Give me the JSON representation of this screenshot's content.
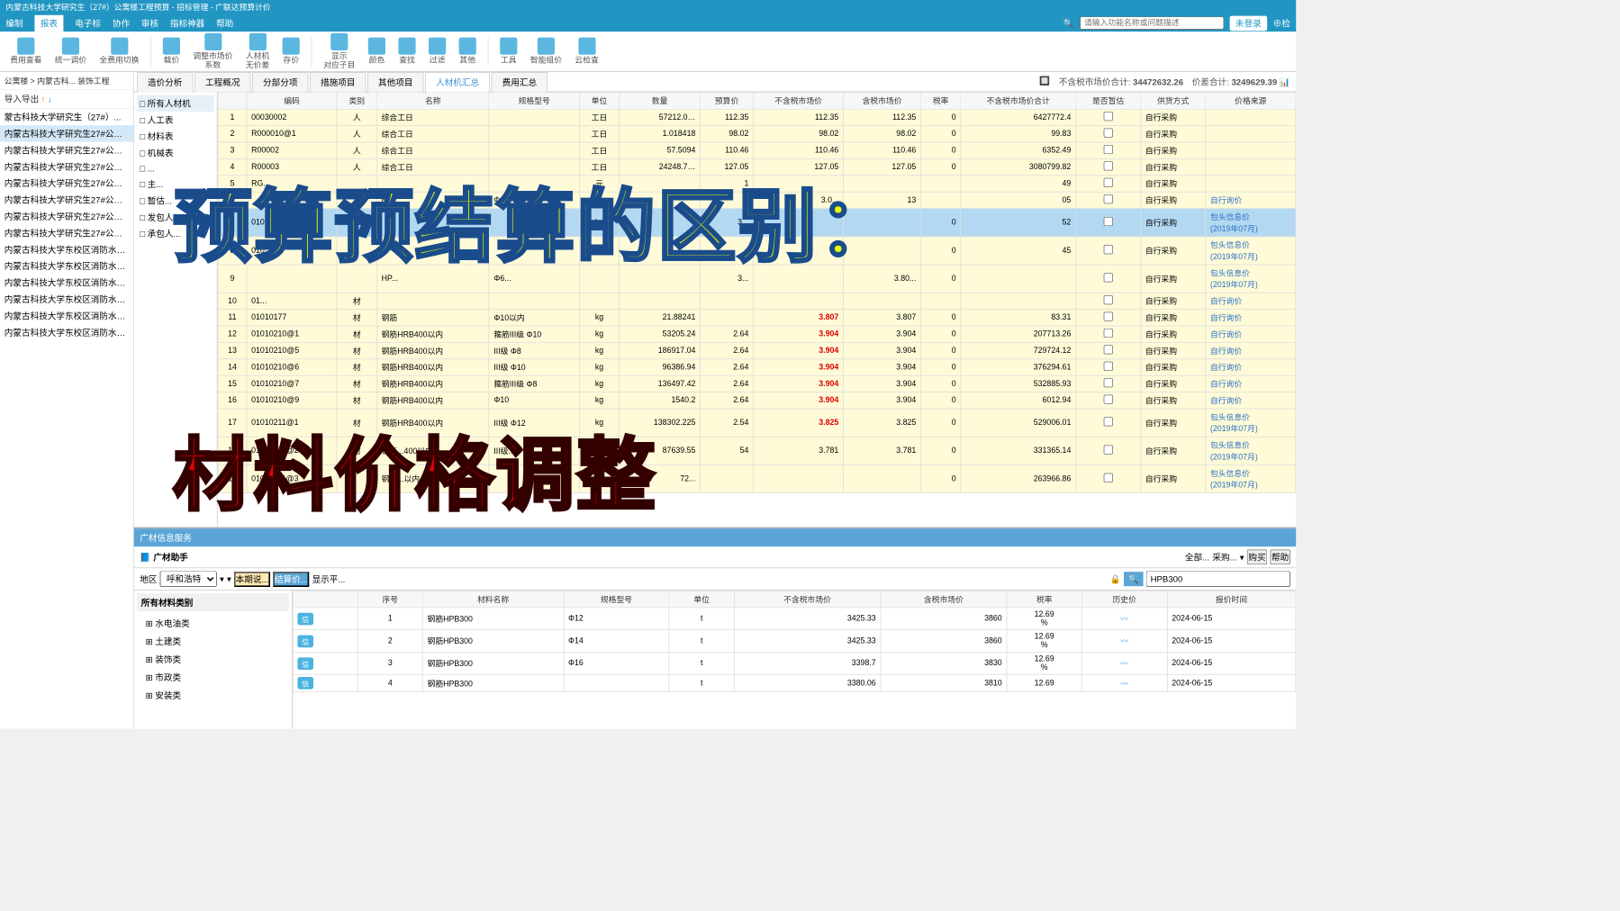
{
  "title_bar": "内蒙古科技大学研究生（27#）公寓楼工程预算 - 招标管理 - 广联达预算计价",
  "menu": [
    "编制",
    "报表",
    "电子标",
    "协作",
    "审核",
    "指标神器",
    "帮助"
  ],
  "search_placeholder": "请输入功能名称或问题描述",
  "login_btn": "未登录",
  "toolbar": [
    "费用查看",
    "统一调价",
    "全费用切换",
    "|",
    "载价",
    "调整市场价\n系数",
    "人材机\n无价差",
    "存价",
    "|",
    "显示\n对应子目",
    "颜色",
    "查找",
    "过滤",
    "其他",
    "|",
    "工具",
    "智能组价",
    "云检查"
  ],
  "breadcrumb": "公寓楼 > 内蒙古科... 装饰工程",
  "export_label": "导入导出",
  "projects": [
    "蒙古科技大学研究生（27#）...",
    "内蒙古科技大学研究生27#公寓...",
    "内蒙古科技大学研究生27#公寓...",
    "内蒙古科技大学研究生27#公寓...",
    "内蒙古科技大学研究生27#公寓...",
    "内蒙古科技大学研究生27#公寓...",
    "内蒙古科技大学研究生27#公寓...",
    "内蒙古科技大学研究生27#公寓...",
    "内蒙古科技大学东校区消防水池...",
    "内蒙古科技大学东校区消防水池...",
    "内蒙古科技大学东校区消防水池...",
    "内蒙古科技大学东校区消防水池...",
    "内蒙古科技大学东校区消防水池...",
    "内蒙古科技大学东校区消防水池..."
  ],
  "tabs": [
    "造价分析",
    "工程概况",
    "分部分项",
    "措施项目",
    "其他项目",
    "人材机汇总",
    "费用汇总"
  ],
  "summary": {
    "market_label": "不含税市场价合计:",
    "market_val": "34472632.26",
    "diff_label": "价差合计:",
    "diff_val": "3249629.39"
  },
  "tree": [
    "□ 所有人材机",
    "  □ 人工表",
    "  □ 材料表",
    "  □ 机械表",
    "  □ ...",
    "□ 主...",
    "□ 暂估...",
    "□ 发包人...",
    "□ 承包人..."
  ],
  "columns": [
    "编码",
    "类别",
    "名称",
    "规格型号",
    "单位",
    "数量",
    "预算价",
    "不含税市场价",
    "含税市场价",
    "税率",
    "不含税市场价合计",
    "是否暂估",
    "供货方式",
    "价格来源"
  ],
  "rows": [
    {
      "n": 1,
      "code": "00030002",
      "cat": "人",
      "name": "综合工日",
      "spec": "",
      "unit": "工日",
      "qty": "57212.0…",
      "budget": "112.35",
      "nt": "112.35",
      "t": "112.35",
      "rate": "0",
      "total": "6427772.4",
      "supply": "自行采购",
      "src": ""
    },
    {
      "n": 2,
      "code": "R000010@1",
      "cat": "人",
      "name": "综合工日",
      "spec": "",
      "unit": "工日",
      "qty": "1.018418",
      "budget": "98.02",
      "nt": "98.02",
      "t": "98.02",
      "rate": "0",
      "total": "99.83",
      "supply": "自行采购",
      "src": ""
    },
    {
      "n": 3,
      "code": "R00002",
      "cat": "人",
      "name": "综合工日",
      "spec": "",
      "unit": "工日",
      "qty": "57.5094",
      "budget": "110.46",
      "nt": "110.46",
      "t": "110.46",
      "rate": "0",
      "total": "6352.49",
      "supply": "自行采购",
      "src": ""
    },
    {
      "n": 4,
      "code": "R00003",
      "cat": "人",
      "name": "综合工日",
      "spec": "",
      "unit": "工日",
      "qty": "24248.7…",
      "budget": "127.05",
      "nt": "127.05",
      "t": "127.05",
      "rate": "0",
      "total": "3080799.82",
      "supply": "自行采购",
      "src": ""
    },
    {
      "n": 5,
      "code": "RG...",
      "cat": "",
      "name": "",
      "spec": "",
      "unit": "元",
      "qty": "",
      "budget": "1",
      "nt": "",
      "t": "",
      "rate": "",
      "total": "49",
      "supply": "自行采购",
      "src": ""
    },
    {
      "n": 6,
      "code": "",
      "cat": "",
      "name": "HP...",
      "spec": "Φ...",
      "unit": "",
      "qty": "",
      "budget": "",
      "nt": "3.0...",
      "t": "13",
      "rate": "",
      "total": "05",
      "supply": "自行采购",
      "src": "自行询价"
    },
    {
      "n": 7,
      "code": "010...",
      "cat": "",
      "name": "",
      "spec": "",
      "unit": "kg",
      "qty": "",
      "budget": "3...",
      "nt": "",
      "t": "",
      "rate": "0",
      "total": "52",
      "supply": "自行采购",
      "src": "包头信息价\n(2019年07月)",
      "sel": true
    },
    {
      "n": 8,
      "code": "010...",
      "cat": "",
      "name": "",
      "spec": "",
      "unit": "kg",
      "qty": "",
      "budget": "",
      "nt": "",
      "t": "",
      "rate": "0",
      "total": "45",
      "supply": "自行采购",
      "src": "包头信息价\n(2019年07月)"
    },
    {
      "n": 9,
      "code": "",
      "cat": "",
      "name": "HP...",
      "spec": "Φ6...",
      "unit": "",
      "qty": "",
      "budget": "3...",
      "nt": "",
      "t": "3.80...",
      "rate": "0",
      "total": "",
      "supply": "自行采购",
      "src": "包头信息价\n(2019年07月)"
    },
    {
      "n": 10,
      "code": "01...",
      "cat": "材",
      "name": "",
      "spec": "",
      "unit": "",
      "qty": "",
      "budget": "",
      "nt": "",
      "t": "",
      "rate": "",
      "total": "",
      "supply": "自行采购",
      "src": "自行询价"
    },
    {
      "n": 11,
      "code": "01010177",
      "cat": "材",
      "name": "钢筋",
      "spec": "Φ10以内",
      "unit": "kg",
      "qty": "21.88241",
      "budget": "",
      "nt": "3.807",
      "t": "3.807",
      "rate": "0",
      "total": "83.31",
      "supply": "自行采购",
      "src": "自行询价",
      "hi": true
    },
    {
      "n": 12,
      "code": "01010210@1",
      "cat": "材",
      "name": "钢筋HRB400以内",
      "spec": "箍筋III级 Φ10",
      "unit": "kg",
      "qty": "53205.24",
      "budget": "2.64",
      "nt": "3.904",
      "t": "3.904",
      "rate": "0",
      "total": "207713.26",
      "supply": "自行采购",
      "src": "自行询价",
      "hi": true
    },
    {
      "n": 13,
      "code": "01010210@5",
      "cat": "材",
      "name": "钢筋HRB400以内",
      "spec": "III级 Φ8",
      "unit": "kg",
      "qty": "186917.04",
      "budget": "2.64",
      "nt": "3.904",
      "t": "3.904",
      "rate": "0",
      "total": "729724.12",
      "supply": "自行采购",
      "src": "自行询价",
      "hi": true
    },
    {
      "n": 14,
      "code": "01010210@6",
      "cat": "材",
      "name": "钢筋HRB400以内",
      "spec": "III级 Φ10",
      "unit": "kg",
      "qty": "96386.94",
      "budget": "2.64",
      "nt": "3.904",
      "t": "3.904",
      "rate": "0",
      "total": "376294.61",
      "supply": "自行采购",
      "src": "自行询价",
      "hi": true
    },
    {
      "n": 15,
      "code": "01010210@7",
      "cat": "材",
      "name": "钢筋HRB400以内",
      "spec": "箍筋III级 Φ8",
      "unit": "kg",
      "qty": "136497.42",
      "budget": "2.64",
      "nt": "3.904",
      "t": "3.904",
      "rate": "0",
      "total": "532885.93",
      "supply": "自行采购",
      "src": "自行询价",
      "hi": true
    },
    {
      "n": 16,
      "code": "01010210@9",
      "cat": "材",
      "name": "钢筋HRB400以内",
      "spec": "Φ10",
      "unit": "kg",
      "qty": "1540.2",
      "budget": "2.64",
      "nt": "3.904",
      "t": "3.904",
      "rate": "0",
      "total": "6012.94",
      "supply": "自行采购",
      "src": "自行询价",
      "hi": true
    },
    {
      "n": 17,
      "code": "01010211@1",
      "cat": "材",
      "name": "钢筋HRB400以内",
      "spec": "III级 Φ12",
      "unit": "kg",
      "qty": "138302.225",
      "budget": "2.54",
      "nt": "3.825",
      "t": "3.825",
      "rate": "0",
      "total": "529006.01",
      "supply": "自行采购",
      "src": "包头信息价\n(2019年07月)",
      "hi": true
    },
    {
      "n": 18,
      "code": "01010211@2",
      "cat": "材",
      "name": "钢筋...400以内",
      "spec": "III级...",
      "unit": "kg",
      "qty": "87639.55",
      "budget": "54",
      "nt": "3.781",
      "t": "3.781",
      "rate": "0",
      "total": "331365.14",
      "supply": "自行采购",
      "src": "包头信息价\n(2019年07月)"
    },
    {
      "n": 19,
      "code": "01010211@3",
      "cat": "",
      "name": "钢筋...以内",
      "spec": "",
      "unit": "kg",
      "qty": "72...",
      "budget": "",
      "nt": "",
      "t": "",
      "rate": "0",
      "total": "263966.86",
      "supply": "自行采购",
      "src": "包头信息价\n(2019年07月)"
    }
  ],
  "price_service": "广材信息服务",
  "price_helper": "广材助手",
  "buy_btn": "购买",
  "help_btn": "帮助",
  "region_label": "地区",
  "region_val": "呼和浩特",
  "period_btn": "本期说...",
  "settle_btn": "结算价...",
  "avg_label": "显示平...",
  "search_code": "HPB300",
  "mat_hdr": "所有材料类别",
  "mat_cats": [
    "⊞ 水电油类",
    "⊞ 土建类",
    "⊞ 装饰类",
    "⊞ 市政类",
    "⊞ 安装类"
  ],
  "bottom_cols": [
    "序号",
    "材料名称",
    "规格型号",
    "单位",
    "不含税市场价",
    "含税市场价",
    "税率",
    "历史价",
    "报价时间"
  ],
  "bottom_rows": [
    {
      "n": 1,
      "name": "钢筋HPB300",
      "spec": "Φ12",
      "unit": "t",
      "nt": "3425.33",
      "t": "3860",
      "rate": "12.69\n%",
      "date": "2024-06-15"
    },
    {
      "n": 2,
      "name": "钢筋HPB300",
      "spec": "Φ14",
      "unit": "t",
      "nt": "3425.33",
      "t": "3860",
      "rate": "12.69\n%",
      "date": "2024-06-15"
    },
    {
      "n": 3,
      "name": "钢筋HPB300",
      "spec": "Φ16",
      "unit": "t",
      "nt": "3398.7",
      "t": "3830",
      "rate": "12.69\n%",
      "date": "2024-06-15"
    },
    {
      "n": 4,
      "name": "钢筋HPB300",
      "spec": "",
      "unit": "t",
      "nt": "3380.06",
      "t": "3810",
      "rate": "12.69",
      "date": "2024-06-15"
    }
  ],
  "overlay1": "预算预结算的区别：",
  "overlay2": "材料价格调整",
  "info_badge": "信"
}
